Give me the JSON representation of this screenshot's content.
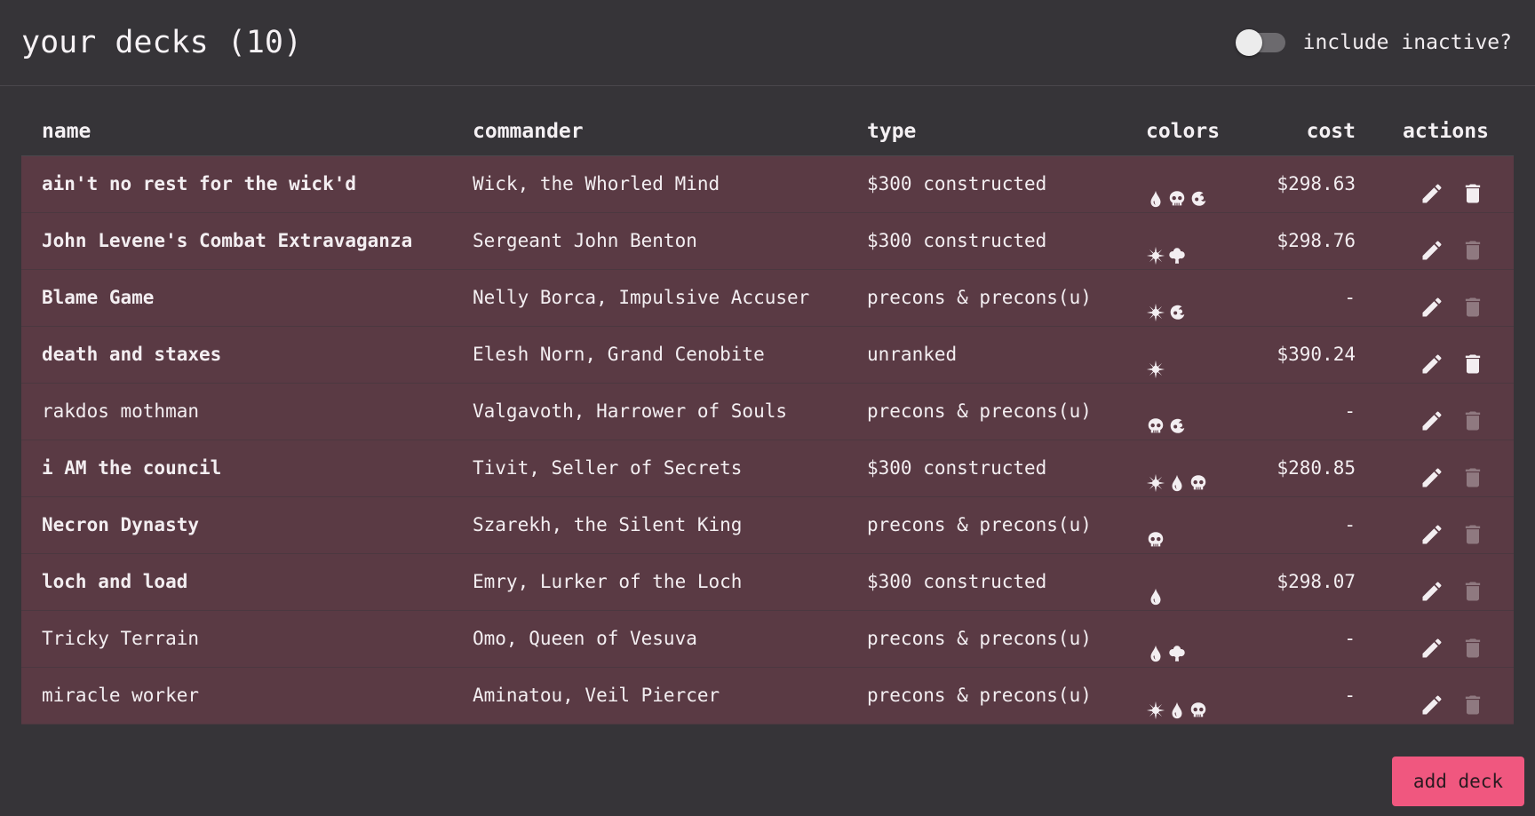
{
  "header": {
    "title": "your decks (10)",
    "toggle": {
      "label": "include inactive?",
      "checked": false
    }
  },
  "table": {
    "columns": [
      "name",
      "commander",
      "type",
      "colors",
      "cost",
      "actions"
    ],
    "rows": [
      {
        "name": "ain't no rest for the wick'd",
        "bold": true,
        "commander": "Wick, the Whorled Mind",
        "type": "$300 constructed",
        "colors": [
          "blue-mana-icon",
          "black-mana-icon",
          "red-mana-icon"
        ],
        "cost": "$298.63",
        "delete_enabled": true
      },
      {
        "name": "John Levene's Combat Extravaganza",
        "bold": true,
        "commander": "Sergeant John Benton",
        "type": "$300 constructed",
        "colors": [
          "white-mana-icon",
          "green-mana-icon"
        ],
        "cost": "$298.76",
        "delete_enabled": false
      },
      {
        "name": "Blame Game",
        "bold": true,
        "commander": "Nelly Borca, Impulsive Accuser",
        "type": "precons & precons(u)",
        "colors": [
          "white-mana-icon",
          "red-mana-icon"
        ],
        "cost": "-",
        "delete_enabled": false
      },
      {
        "name": "death and staxes",
        "bold": true,
        "commander": "Elesh Norn, Grand Cenobite",
        "type": "unranked",
        "colors": [
          "white-mana-icon"
        ],
        "cost": "$390.24",
        "delete_enabled": true
      },
      {
        "name": "rakdos mothman",
        "bold": false,
        "commander": "Valgavoth, Harrower of Souls",
        "type": "precons & precons(u)",
        "colors": [
          "black-mana-icon",
          "red-mana-icon"
        ],
        "cost": "-",
        "delete_enabled": false
      },
      {
        "name": "i AM the council",
        "bold": true,
        "commander": "Tivit, Seller of Secrets",
        "type": "$300 constructed",
        "colors": [
          "white-mana-icon",
          "blue-mana-icon",
          "black-mana-icon"
        ],
        "cost": "$280.85",
        "delete_enabled": false
      },
      {
        "name": "Necron Dynasty",
        "bold": true,
        "commander": "Szarekh, the Silent King",
        "type": "precons & precons(u)",
        "colors": [
          "black-mana-icon"
        ],
        "cost": "-",
        "delete_enabled": false
      },
      {
        "name": "loch and load",
        "bold": true,
        "commander": "Emry, Lurker of the Loch",
        "type": "$300 constructed",
        "colors": [
          "blue-mana-icon"
        ],
        "cost": "$298.07",
        "delete_enabled": false
      },
      {
        "name": "Tricky Terrain",
        "bold": false,
        "commander": "Omo, Queen of Vesuva",
        "type": "precons & precons(u)",
        "colors": [
          "blue-mana-icon",
          "green-mana-icon"
        ],
        "cost": "-",
        "delete_enabled": false
      },
      {
        "name": "miracle worker",
        "bold": false,
        "commander": "Aminatou, Veil Piercer",
        "type": "precons & precons(u)",
        "colors": [
          "white-mana-icon",
          "blue-mana-icon",
          "black-mana-icon"
        ],
        "cost": "-",
        "delete_enabled": false
      }
    ]
  },
  "footer": {
    "add_label": "add deck"
  },
  "colors": {
    "background": "#363438",
    "row": "#5a3a44",
    "accent": "#f0577f"
  }
}
